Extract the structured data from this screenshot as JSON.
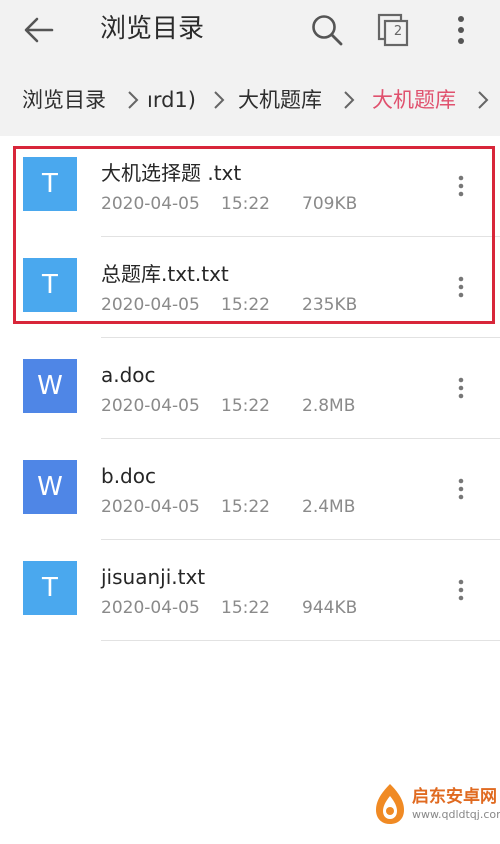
{
  "header": {
    "title": "浏览目录",
    "windows_count": "2",
    "icons": {
      "back": "back-arrow-icon",
      "search": "search-icon",
      "windows": "windows-icon",
      "more": "more-vertical-icon"
    }
  },
  "breadcrumb": {
    "items": [
      {
        "label": "浏览目录",
        "active": false
      },
      {
        "label": "ırd1)",
        "active": false
      },
      {
        "label": "大机题库",
        "active": false
      },
      {
        "label": "大机题库",
        "active": true
      }
    ],
    "active_color": "#e0516e"
  },
  "files": [
    {
      "name": "大机选择题 .txt",
      "date": "2020-04-05",
      "time": "15:22",
      "size": "709KB",
      "icon_letter": "T",
      "type": "txt"
    },
    {
      "name": "总题库.txt.txt",
      "date": "2020-04-05",
      "time": "15:22",
      "size": "235KB",
      "icon_letter": "T",
      "type": "txt"
    },
    {
      "name": "a.doc",
      "date": "2020-04-05",
      "time": "15:22",
      "size": "2.8MB",
      "icon_letter": "W",
      "type": "doc"
    },
    {
      "name": "b.doc",
      "date": "2020-04-05",
      "time": "15:22",
      "size": "2.4MB",
      "icon_letter": "W",
      "type": "doc"
    },
    {
      "name": "jisuanji.txt",
      "date": "2020-04-05",
      "time": "15:22",
      "size": "944KB",
      "icon_letter": "T",
      "type": "txt"
    }
  ],
  "colors": {
    "txt_icon": "#4aa8ee",
    "doc_icon": "#4f86e6",
    "highlight": "#d8263a",
    "header_bg": "#f2f2f2"
  },
  "watermark": {
    "title": "启东安卓网",
    "url": "www.qdldtqj.com"
  }
}
